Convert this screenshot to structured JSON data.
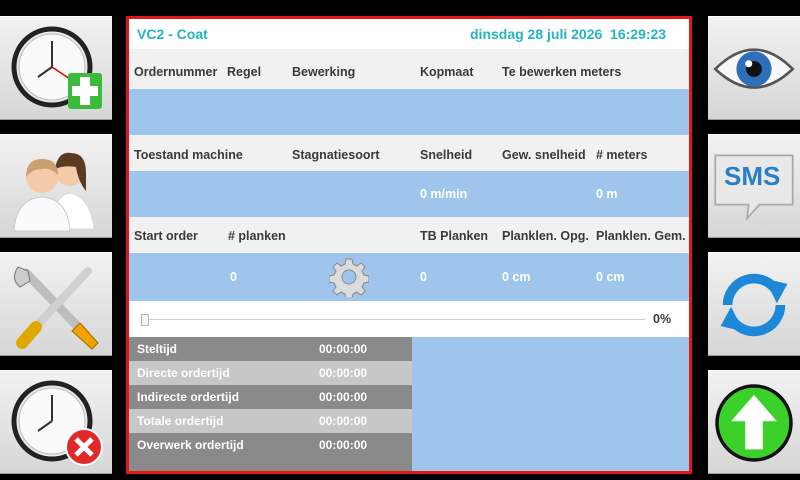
{
  "header": {
    "title": "VC2 - Coat",
    "datetime": "dinsdag 28 juli 2026  16:29:23"
  },
  "order_headers": [
    "Ordernummer",
    "Regel",
    "Bewerking",
    "Kopmaat",
    "Te bewerken meters"
  ],
  "machine_headers": [
    "Toestand machine",
    "Stagnatiesoort",
    "Snelheid",
    "Gew. snelheid",
    "# meters"
  ],
  "machine_values": {
    "snelheid": "0 m/min",
    "meters": "0 m"
  },
  "start_headers": [
    "Start order",
    "# planken",
    "TB Planken",
    "Planklen. Opg.",
    "Planklen. Gem."
  ],
  "start_values": {
    "planken": "0",
    "tb_planken": "0",
    "planklen_opg": "0 cm",
    "planklen_gem": "0 cm"
  },
  "progress": {
    "value": 0,
    "label": "0%"
  },
  "times": [
    {
      "label": "Steltijd",
      "value": "00:00:00"
    },
    {
      "label": "Directe ordertijd",
      "value": "00:00:00"
    },
    {
      "label": "Indirecte ordertijd",
      "value": "00:00:00"
    },
    {
      "label": "Totale ordertijd",
      "value": "00:00:00"
    },
    {
      "label": "Overwerk ordertijd",
      "value": "00:00:00"
    }
  ],
  "sidebar_right": {
    "sms_label": "SMS"
  },
  "colors": {
    "accent": "#23b4c2",
    "border": "#e01818",
    "row_blue": "#9fc5ec"
  },
  "icons": {
    "left": [
      "clock-add-icon",
      "users-icon",
      "tools-icon",
      "clock-cancel-icon"
    ],
    "right": [
      "eye-icon",
      "sms-icon",
      "refresh-icon",
      "upload-icon"
    ]
  }
}
